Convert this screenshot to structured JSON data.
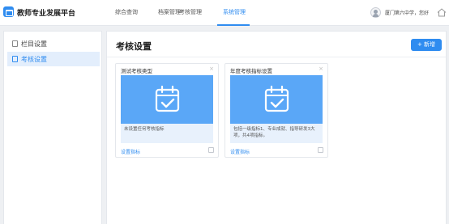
{
  "app": {
    "title": "教师专业发展平台"
  },
  "nav": {
    "tabs": [
      {
        "label": "综合查询"
      },
      {
        "label": "档案管理"
      },
      {
        "label": "考核管理"
      },
      {
        "label": "系统管理"
      }
    ],
    "active_tab": "系统管理"
  },
  "user": {
    "name": "厦门第六中学，您好"
  },
  "sidebar": {
    "items": [
      {
        "label": "栏目设置",
        "icon": "columns-icon"
      },
      {
        "label": "考核设置",
        "icon": "document-icon",
        "active": true
      }
    ]
  },
  "main": {
    "title": "考核设置",
    "add_button": "+ 新增",
    "cards": [
      {
        "title": "测试考核类型",
        "description": "未设置任何考核指标",
        "link": "设置指标"
      },
      {
        "title": "年度考核指标设置",
        "description": "包括一级指标1、专业成就、指导研发3大项，共4项指标。",
        "link": "设置指标"
      }
    ]
  },
  "colors": {
    "accent": "#2f8cf0",
    "banner": "#5aa7f7",
    "desc_bg": "#e8f1fc"
  }
}
